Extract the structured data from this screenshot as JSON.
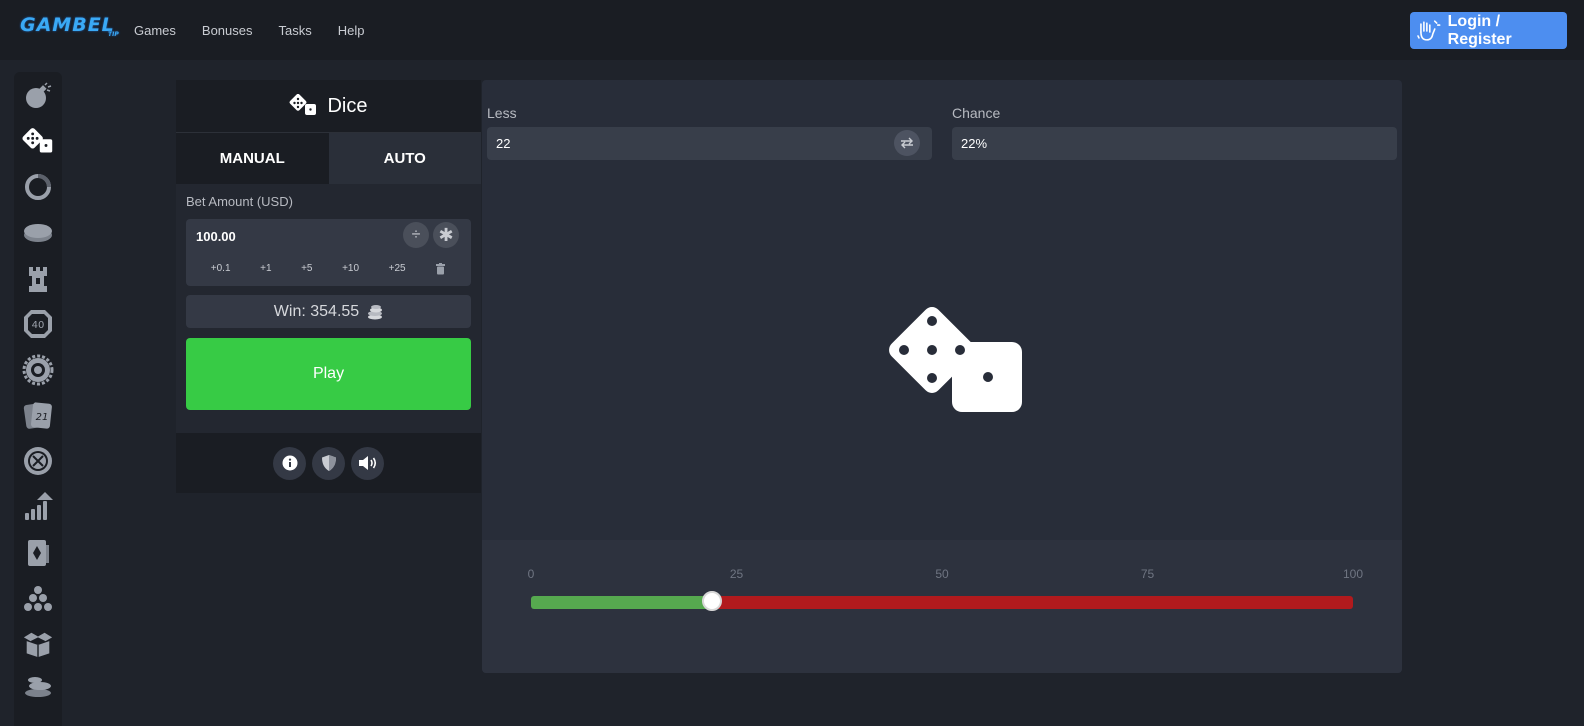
{
  "topbar": {
    "logo_text": "GAMBEL",
    "logo_sub": "TIP",
    "nav": [
      "Games",
      "Bonuses",
      "Tasks",
      "Help"
    ],
    "login_label": "Login / Register",
    "login_icon": "hand-wave-icon"
  },
  "sidebar": {
    "items": [
      {
        "icon": "bomb-icon"
      },
      {
        "icon": "dice-icon",
        "active": true
      },
      {
        "icon": "ring-icon"
      },
      {
        "icon": "coin-icon"
      },
      {
        "icon": "tower-icon"
      },
      {
        "icon": "keno-40-icon",
        "text": "40"
      },
      {
        "icon": "wheel-icon"
      },
      {
        "icon": "blackjack-21-icon",
        "text": "21"
      },
      {
        "icon": "roulette-icon"
      },
      {
        "icon": "crash-chart-icon"
      },
      {
        "icon": "card-icon"
      },
      {
        "icon": "plinko-icon"
      },
      {
        "icon": "box-icon"
      },
      {
        "icon": "stack-icon"
      }
    ]
  },
  "panel": {
    "title": "Dice",
    "tabs": {
      "manual": "MANUAL",
      "auto": "AUTO"
    },
    "bet_label": "Bet Amount (USD)",
    "bet_value": "100.00",
    "divide_symbol": "÷",
    "multiply_symbol": "✱",
    "quick_amounts": [
      "+0.1",
      "+1",
      "+5",
      "+10",
      "+25"
    ],
    "win_text": "Win: 354.55",
    "play_label": "Play",
    "footer_icons": [
      "info-icon",
      "shield-icon",
      "sound-icon"
    ]
  },
  "game": {
    "less_label": "Less",
    "less_value": "22",
    "chance_label": "Chance",
    "chance_value": "22%",
    "slider": {
      "ticks": [
        "0",
        "25",
        "50",
        "75",
        "100"
      ],
      "value": 22,
      "min": 0,
      "max": 100,
      "under_color": "#56a94f",
      "over_color": "#b11a1d"
    }
  },
  "colors": {
    "accent_blue": "#4d8ef0",
    "play_green": "#37cb45",
    "background": "#1f232b"
  }
}
